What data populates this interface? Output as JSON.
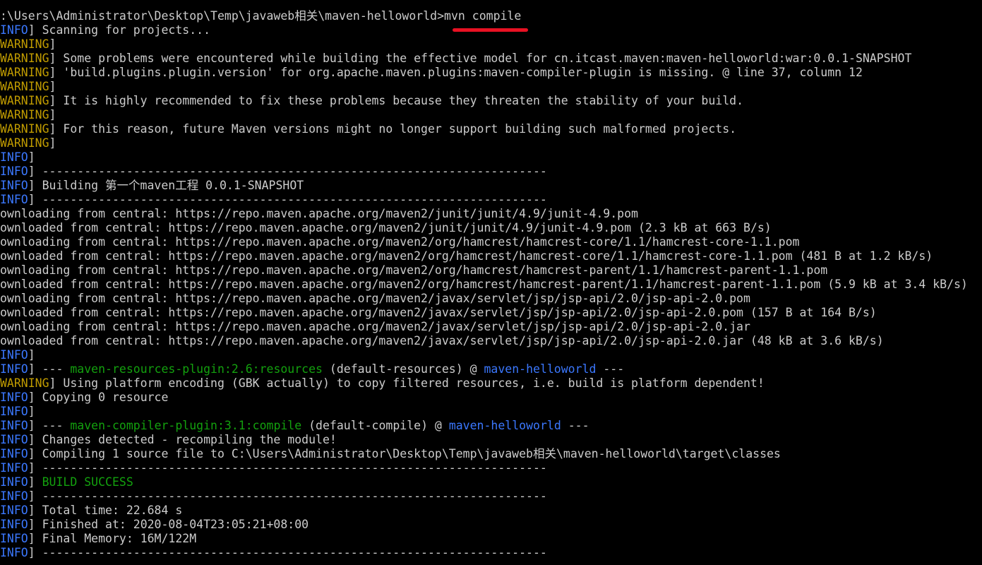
{
  "colors": {
    "background": "#000000",
    "text": "#cccccc",
    "info": "#3b78ff",
    "warning": "#c19c00",
    "success": "#13a10e",
    "highlight_underline": "#e81123"
  },
  "terminal": {
    "lines": [
      {
        "segs": [
          {
            "t": ":\\Users\\Administrator\\Desktop\\Temp\\javaweb相关\\maven-helloworld>mvn compile"
          }
        ]
      },
      {
        "segs": [
          {
            "t": "INFO",
            "c": "info"
          },
          {
            "t": "] Scanning for projects..."
          }
        ]
      },
      {
        "segs": [
          {
            "t": "WARNING",
            "c": "warn"
          },
          {
            "t": "]"
          }
        ]
      },
      {
        "segs": [
          {
            "t": "WARNING",
            "c": "warn"
          },
          {
            "t": "] Some problems were encountered while building the effective model for cn.itcast.maven:maven-helloworld:war:0.0.1-SNAPSHOT"
          }
        ]
      },
      {
        "segs": [
          {
            "t": "WARNING",
            "c": "warn"
          },
          {
            "t": "] 'build.plugins.plugin.version' for org.apache.maven.plugins:maven-compiler-plugin is missing. @ line 37, column 12"
          }
        ]
      },
      {
        "segs": [
          {
            "t": "WARNING",
            "c": "warn"
          },
          {
            "t": "]"
          }
        ]
      },
      {
        "segs": [
          {
            "t": "WARNING",
            "c": "warn"
          },
          {
            "t": "] It is highly recommended to fix these problems because they threaten the stability of your build."
          }
        ]
      },
      {
        "segs": [
          {
            "t": "WARNING",
            "c": "warn"
          },
          {
            "t": "]"
          }
        ]
      },
      {
        "segs": [
          {
            "t": "WARNING",
            "c": "warn"
          },
          {
            "t": "] For this reason, future Maven versions might no longer support building such malformed projects."
          }
        ]
      },
      {
        "segs": [
          {
            "t": "WARNING",
            "c": "warn"
          },
          {
            "t": "]"
          }
        ]
      },
      {
        "segs": [
          {
            "t": "INFO",
            "c": "info"
          },
          {
            "t": "]"
          }
        ]
      },
      {
        "segs": [
          {
            "t": "INFO",
            "c": "info"
          },
          {
            "t": "] ------------------------------------------------------------------------"
          }
        ]
      },
      {
        "segs": [
          {
            "t": "INFO",
            "c": "info"
          },
          {
            "t": "] Building 第一个maven工程 0.0.1-SNAPSHOT"
          }
        ]
      },
      {
        "segs": [
          {
            "t": "INFO",
            "c": "info"
          },
          {
            "t": "] ------------------------------------------------------------------------"
          }
        ]
      },
      {
        "segs": [
          {
            "t": "ownloading from central: https://repo.maven.apache.org/maven2/junit/junit/4.9/junit-4.9.pom"
          }
        ]
      },
      {
        "segs": [
          {
            "t": "ownloaded from central: https://repo.maven.apache.org/maven2/junit/junit/4.9/junit-4.9.pom (2.3 kB at 663 B/s)"
          }
        ]
      },
      {
        "segs": [
          {
            "t": "ownloading from central: https://repo.maven.apache.org/maven2/org/hamcrest/hamcrest-core/1.1/hamcrest-core-1.1.pom"
          }
        ]
      },
      {
        "segs": [
          {
            "t": "ownloaded from central: https://repo.maven.apache.org/maven2/org/hamcrest/hamcrest-core/1.1/hamcrest-core-1.1.pom (481 B at 1.2 kB/s)"
          }
        ]
      },
      {
        "segs": [
          {
            "t": "ownloading from central: https://repo.maven.apache.org/maven2/org/hamcrest/hamcrest-parent/1.1/hamcrest-parent-1.1.pom"
          }
        ]
      },
      {
        "segs": [
          {
            "t": "ownloaded from central: https://repo.maven.apache.org/maven2/org/hamcrest/hamcrest-parent/1.1/hamcrest-parent-1.1.pom (5.9 kB at 3.4 kB/s)"
          }
        ]
      },
      {
        "segs": [
          {
            "t": "ownloading from central: https://repo.maven.apache.org/maven2/javax/servlet/jsp/jsp-api/2.0/jsp-api-2.0.pom"
          }
        ]
      },
      {
        "segs": [
          {
            "t": "ownloaded from central: https://repo.maven.apache.org/maven2/javax/servlet/jsp/jsp-api/2.0/jsp-api-2.0.pom (157 B at 164 B/s)"
          }
        ]
      },
      {
        "segs": [
          {
            "t": "ownloading from central: https://repo.maven.apache.org/maven2/javax/servlet/jsp/jsp-api/2.0/jsp-api-2.0.jar"
          }
        ]
      },
      {
        "segs": [
          {
            "t": "ownloaded from central: https://repo.maven.apache.org/maven2/javax/servlet/jsp/jsp-api/2.0/jsp-api-2.0.jar (48 kB at 3.6 kB/s)"
          }
        ]
      },
      {
        "segs": [
          {
            "t": "INFO",
            "c": "info"
          },
          {
            "t": "]"
          }
        ]
      },
      {
        "segs": [
          {
            "t": "INFO",
            "c": "info"
          },
          {
            "t": "] --- "
          },
          {
            "t": "maven-resources-plugin:2.6:resources",
            "c": "green"
          },
          {
            "t": " (default-resources) @ "
          },
          {
            "t": "maven-helloworld",
            "c": "cyan"
          },
          {
            "t": " ---"
          }
        ]
      },
      {
        "segs": [
          {
            "t": "WARNING",
            "c": "warn"
          },
          {
            "t": "] Using platform encoding (GBK actually) to copy filtered resources, i.e. build is platform dependent!"
          }
        ]
      },
      {
        "segs": [
          {
            "t": "INFO",
            "c": "info"
          },
          {
            "t": "] Copying 0 resource"
          }
        ]
      },
      {
        "segs": [
          {
            "t": "INFO",
            "c": "info"
          },
          {
            "t": "]"
          }
        ]
      },
      {
        "segs": [
          {
            "t": "INFO",
            "c": "info"
          },
          {
            "t": "] --- "
          },
          {
            "t": "maven-compiler-plugin:3.1:compile",
            "c": "green"
          },
          {
            "t": " (default-compile) @ "
          },
          {
            "t": "maven-helloworld",
            "c": "cyan"
          },
          {
            "t": " ---"
          }
        ]
      },
      {
        "segs": [
          {
            "t": "INFO",
            "c": "info"
          },
          {
            "t": "] Changes detected - recompiling the module!"
          }
        ]
      },
      {
        "segs": [
          {
            "t": "INFO",
            "c": "info"
          },
          {
            "t": "] Compiling 1 source file to C:\\Users\\Administrator\\Desktop\\Temp\\javaweb相关\\maven-helloworld\\target\\classes"
          }
        ]
      },
      {
        "segs": [
          {
            "t": "INFO",
            "c": "info"
          },
          {
            "t": "] ------------------------------------------------------------------------"
          }
        ]
      },
      {
        "segs": [
          {
            "t": "INFO",
            "c": "info"
          },
          {
            "t": "] "
          },
          {
            "t": "BUILD SUCCESS",
            "c": "green"
          }
        ]
      },
      {
        "segs": [
          {
            "t": "INFO",
            "c": "info"
          },
          {
            "t": "] ------------------------------------------------------------------------"
          }
        ]
      },
      {
        "segs": [
          {
            "t": "INFO",
            "c": "info"
          },
          {
            "t": "] Total time: 22.684 s"
          }
        ]
      },
      {
        "segs": [
          {
            "t": "INFO",
            "c": "info"
          },
          {
            "t": "] Finished at: 2020-08-04T23:05:21+08:00"
          }
        ]
      },
      {
        "segs": [
          {
            "t": "INFO",
            "c": "info"
          },
          {
            "t": "] Final Memory: 16M/122M"
          }
        ]
      },
      {
        "segs": [
          {
            "t": "INFO",
            "c": "info"
          },
          {
            "t": "] ------------------------------------------------------------------------"
          }
        ]
      }
    ]
  }
}
